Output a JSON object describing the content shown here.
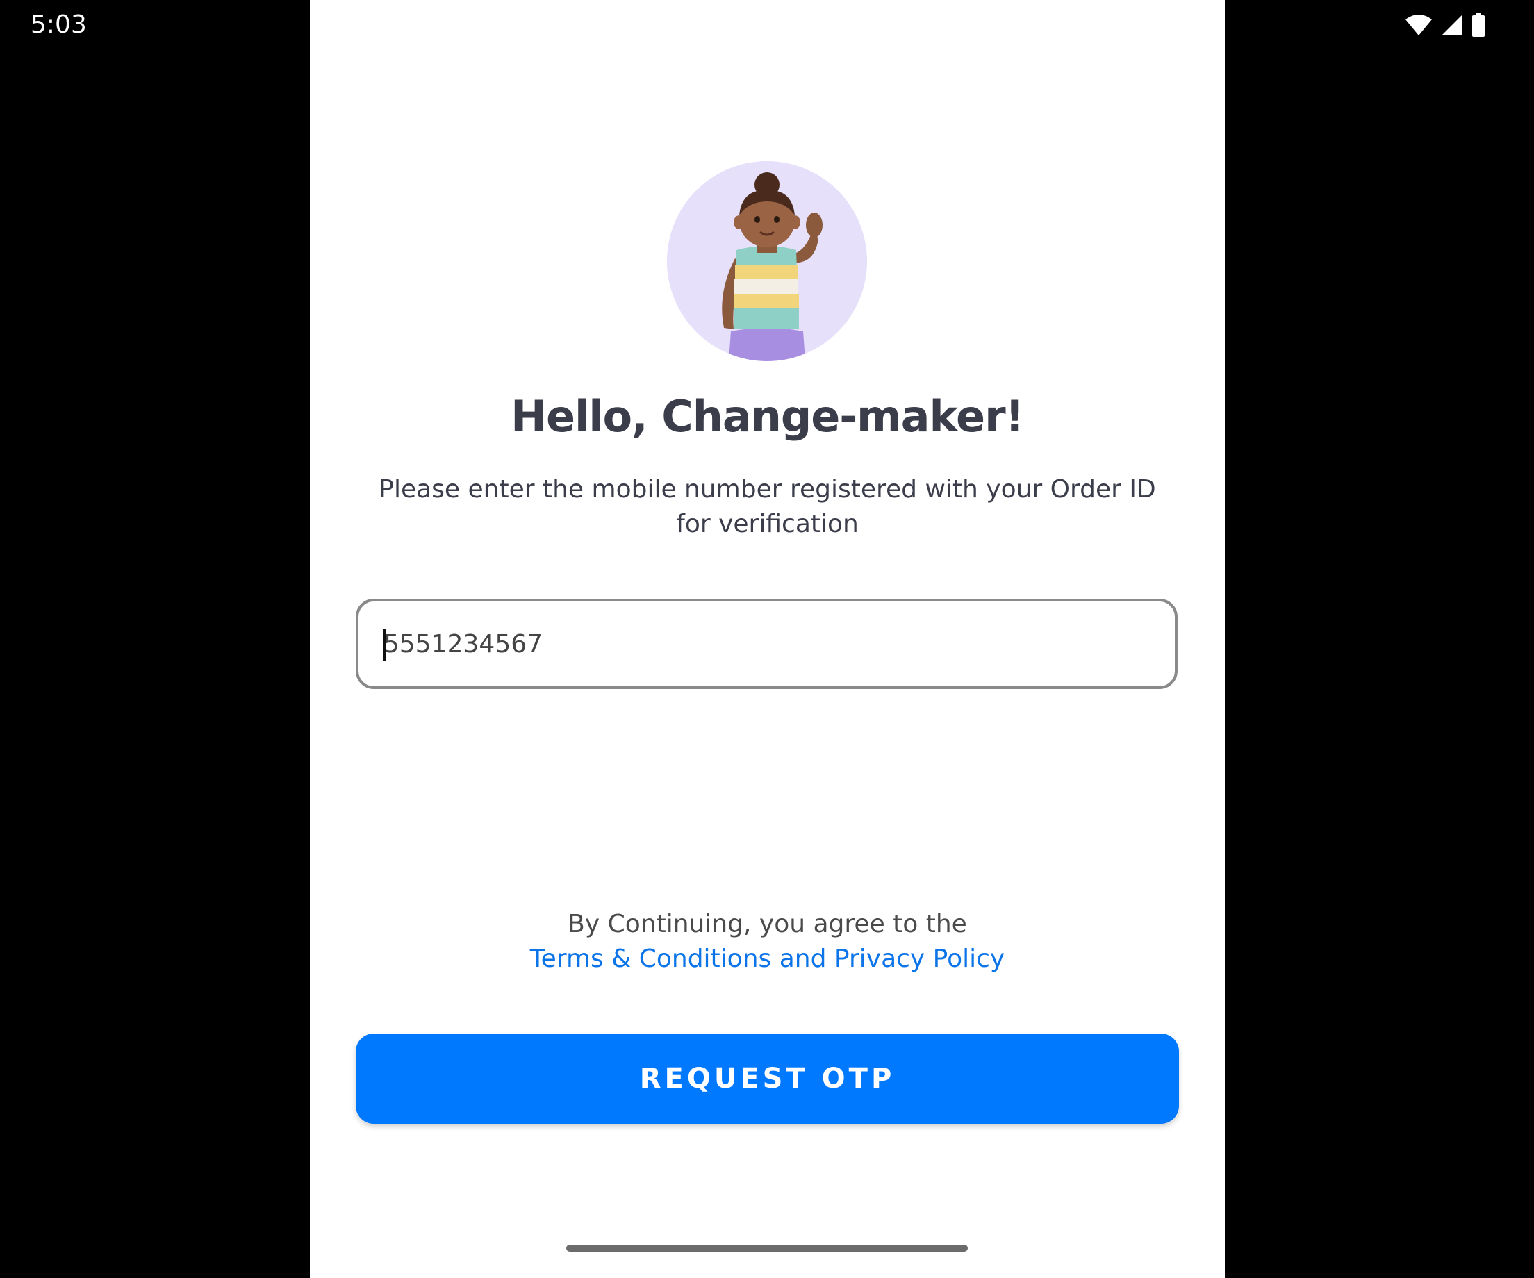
{
  "status_bar": {
    "time": "5:03",
    "icons": [
      "wifi-icon",
      "cellular-signal-icon",
      "battery-icon"
    ]
  },
  "login": {
    "avatar": "waving-person-avatar",
    "title": "Hello, Change-maker!",
    "subtitle": "Please enter the mobile number registered with your Order ID for verification",
    "phone_input_value": "5551234567",
    "agree_text": "By Continuing, you agree to the",
    "terms_link": "Terms & Conditions and Privacy Policy",
    "request_otp_label": "REQUEST OTP"
  },
  "colors": {
    "primary_button": "#0079fe",
    "link": "#0a74e8",
    "avatar_bg": "#e6e0fb",
    "title_text": "#3b3d4a"
  }
}
